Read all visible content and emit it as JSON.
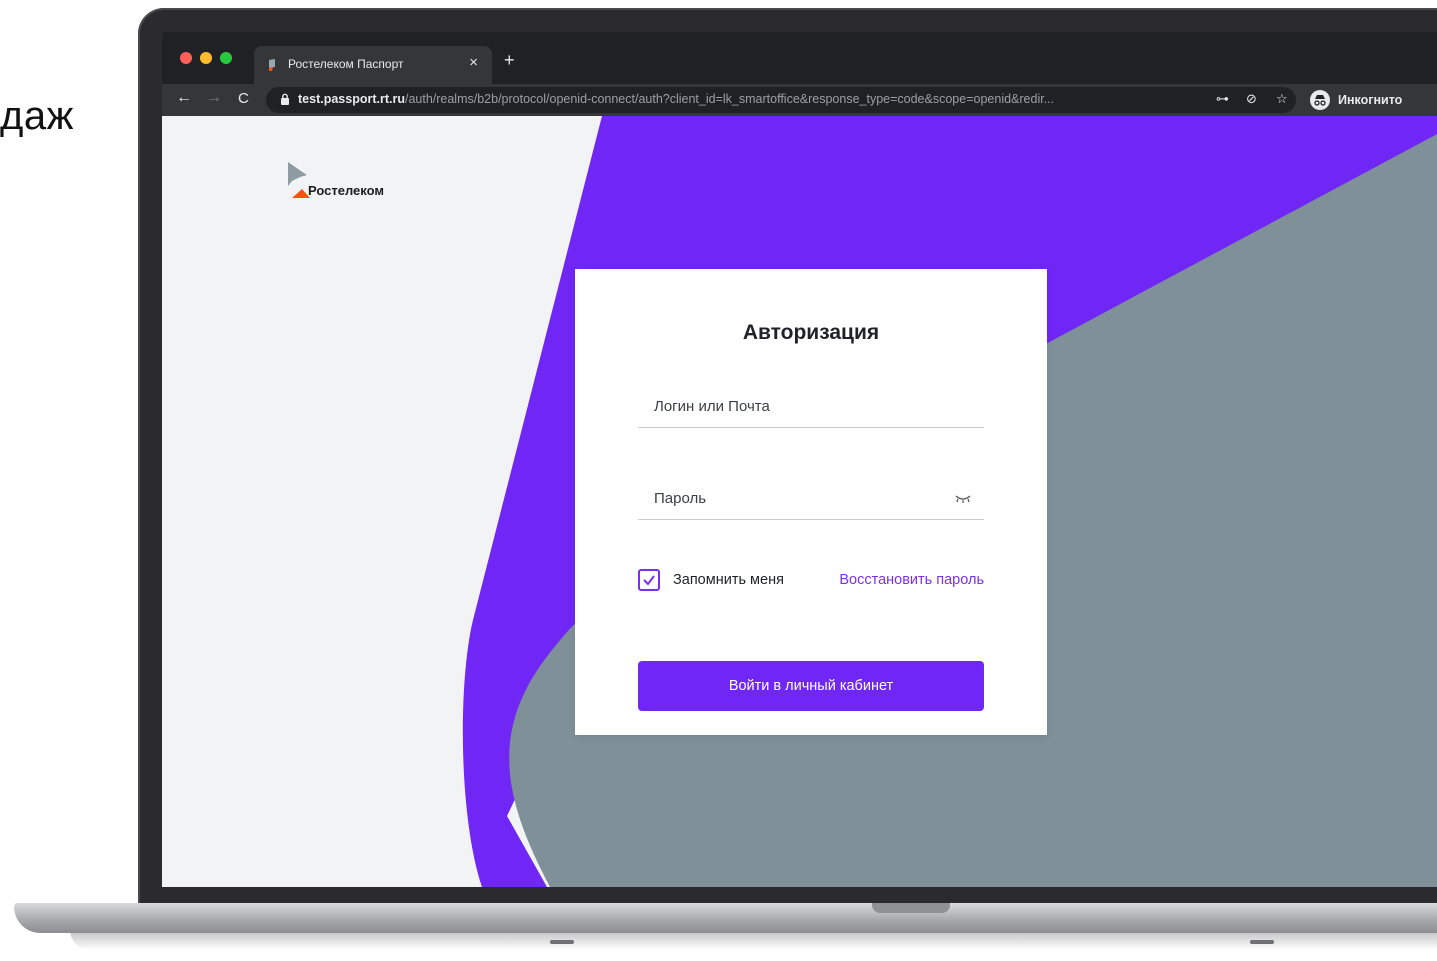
{
  "side_text": "даж",
  "browser": {
    "tab_title": "Ростелеком Паспорт",
    "close_glyph": "×",
    "newtab_glyph": "+",
    "back_glyph": "←",
    "forward_glyph": "→",
    "reload_glyph": "C",
    "url_host": "test.passport.rt.ru",
    "url_path": "/auth/realms/b2b/protocol/openid-connect/auth?client_id=lk_smartoffice&response_type=code&scope=openid&redir...",
    "key_glyph": "⊶",
    "eye_off_glyph": "⊘",
    "star_glyph": "☆",
    "incognito_label": "Инкогнито",
    "icons": [
      "favicon-icon",
      "lock-icon",
      "key-icon",
      "eye-off-icon",
      "star-icon",
      "incognito-icon"
    ]
  },
  "page": {
    "logo_text": "Ростелеком",
    "colors": {
      "purple": "#7027f5",
      "gray": "#7f9098",
      "background": "#f2f3f5",
      "logo_orange": "#ff4f12"
    },
    "form": {
      "title": "Авторизация",
      "login_placeholder": "Логин или Почта",
      "password_placeholder": "Пароль",
      "remember_label": "Запомнить меня",
      "remember_checked": true,
      "restore_link": "Восстановить пароль",
      "submit_label": "Войти в личный кабинет"
    }
  }
}
